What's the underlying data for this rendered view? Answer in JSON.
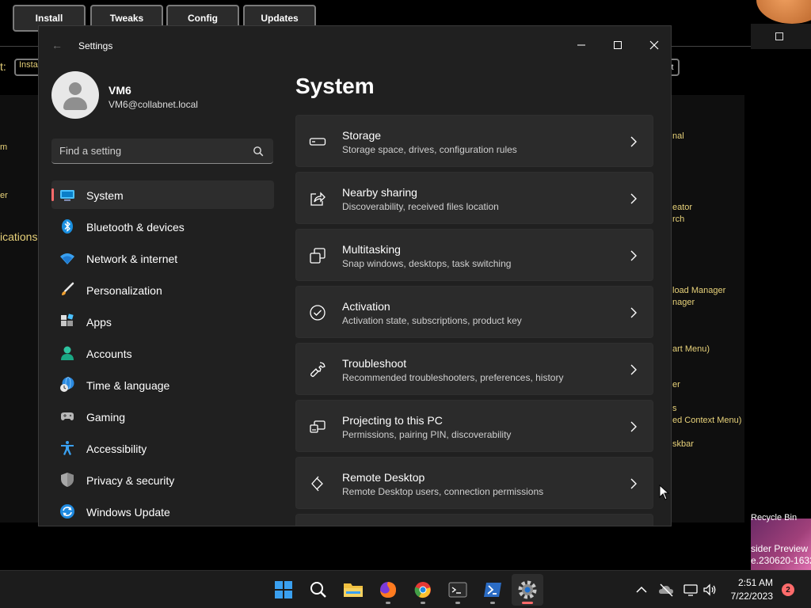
{
  "background_app": {
    "tabs": [
      "Install",
      "Tweaks",
      "Config",
      "Updates"
    ],
    "left_label": "t:",
    "install_field": "Insta",
    "left_texts": [
      "m",
      "er",
      "ications"
    ],
    "right_texts": [
      "nal",
      "eator",
      "rch",
      "load Manager",
      "nager",
      "art Menu)",
      "er",
      "s",
      "ed Context Menu)",
      "skbar"
    ]
  },
  "desktop": {
    "recycle_label": "Recycle Bin",
    "watermark_line1": "sider Preview",
    "watermark_line2": "e.230620-1632"
  },
  "window": {
    "title": "Settings",
    "back_icon": "back-arrow-icon"
  },
  "profile": {
    "name": "VM6",
    "email": "VM6@collabnet.local"
  },
  "search": {
    "placeholder": "Find a setting"
  },
  "nav": [
    {
      "label": "System",
      "icon": "monitor-icon",
      "active": true
    },
    {
      "label": "Bluetooth & devices",
      "icon": "bluetooth-icon"
    },
    {
      "label": "Network & internet",
      "icon": "wifi-icon"
    },
    {
      "label": "Personalization",
      "icon": "brush-icon"
    },
    {
      "label": "Apps",
      "icon": "apps-icon"
    },
    {
      "label": "Accounts",
      "icon": "person-icon"
    },
    {
      "label": "Time & language",
      "icon": "globe-clock-icon"
    },
    {
      "label": "Gaming",
      "icon": "gamepad-icon"
    },
    {
      "label": "Accessibility",
      "icon": "accessibility-icon"
    },
    {
      "label": "Privacy & security",
      "icon": "shield-icon"
    },
    {
      "label": "Windows Update",
      "icon": "update-icon"
    }
  ],
  "page": {
    "title": "System",
    "cards": [
      {
        "title": "Storage",
        "subtitle": "Storage space, drives, configuration rules",
        "icon": "storage-icon"
      },
      {
        "title": "Nearby sharing",
        "subtitle": "Discoverability, received files location",
        "icon": "share-icon"
      },
      {
        "title": "Multitasking",
        "subtitle": "Snap windows, desktops, task switching",
        "icon": "multitask-icon"
      },
      {
        "title": "Activation",
        "subtitle": "Activation state, subscriptions, product key",
        "icon": "check-circle-icon"
      },
      {
        "title": "Troubleshoot",
        "subtitle": "Recommended troubleshooters, preferences, history",
        "icon": "wrench-icon"
      },
      {
        "title": "Projecting to this PC",
        "subtitle": "Permissions, pairing PIN, discoverability",
        "icon": "project-icon"
      },
      {
        "title": "Remote Desktop",
        "subtitle": "Remote Desktop users, connection permissions",
        "icon": "remote-desktop-icon"
      }
    ]
  },
  "taskbar": {
    "time": "2:51 AM",
    "date": "7/22/2023",
    "notification_count": "2",
    "apps": [
      "start-icon",
      "search-icon",
      "file-explorer-icon",
      "firefox-icon",
      "chrome-icon",
      "terminal-icon",
      "powershell-icon",
      "settings-gear-icon"
    ]
  },
  "colors": {
    "accent": "#ff6b6b",
    "window_bg": "#202020",
    "card_bg": "#2b2b2b",
    "bg_app_text": "#e8d27a"
  }
}
